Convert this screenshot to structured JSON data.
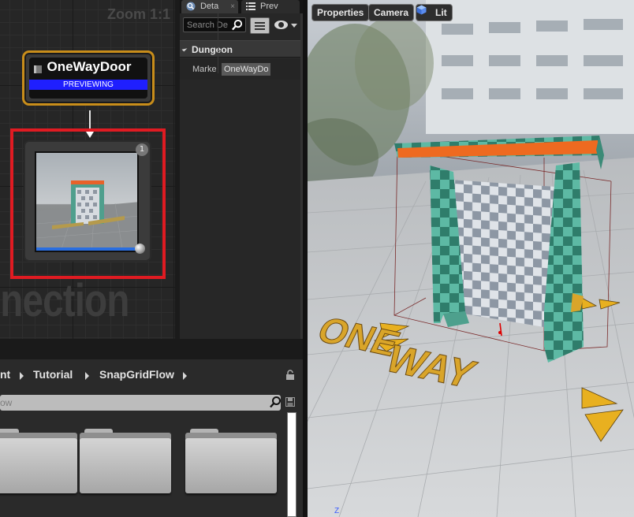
{
  "graph": {
    "zoom_label": "Zoom 1:1",
    "watermark": "nnection",
    "door_node": {
      "title": "OneWayDoor",
      "status": "PREVIEWING"
    },
    "preview_node": {
      "badge": "1"
    }
  },
  "details": {
    "tabs": [
      {
        "label": "Deta",
        "icon": "info-icon"
      },
      {
        "label": "Prev",
        "icon": "list-icon"
      }
    ],
    "search_placeholder": "Search De",
    "category": "Dungeon",
    "property": {
      "name": "Marke",
      "value": "OneWayDo"
    }
  },
  "content_browser": {
    "breadcrumb": [
      "nt",
      "Tutorial",
      "SnapGridFlow"
    ],
    "filter_placeholder": "ow",
    "folders": 3
  },
  "viewport": {
    "buttons": {
      "properties": "Properties",
      "camera": "Camera",
      "lit": "Lit"
    },
    "scene_text": "ONE WAY",
    "axis_label": "Z",
    "colors": {
      "door_teal": "#4fa38f",
      "door_top": "#f06a1a",
      "arrow_yellow": "#e8b020"
    }
  }
}
